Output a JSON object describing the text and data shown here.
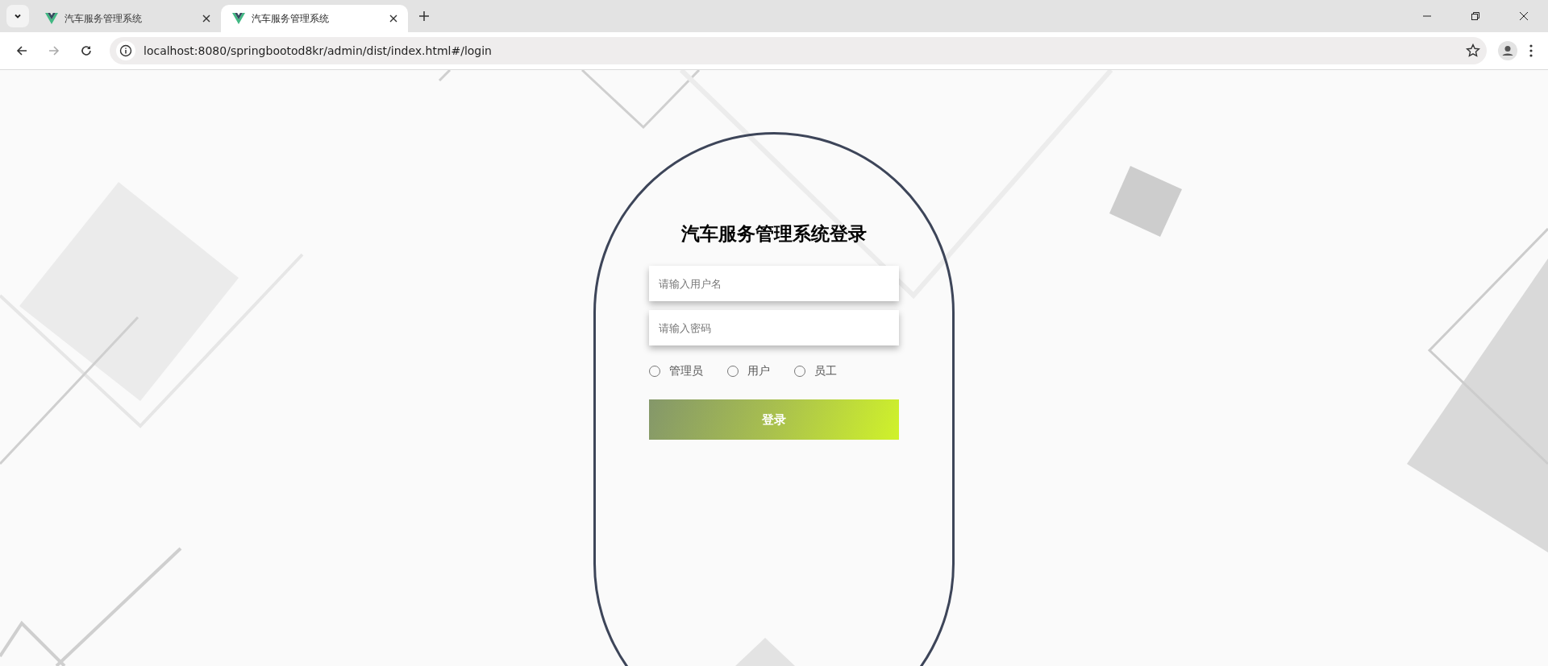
{
  "browser": {
    "tabs": [
      {
        "title": "汽车服务管理系统",
        "selected": false
      },
      {
        "title": "汽车服务管理系统",
        "selected": true
      }
    ],
    "address": "localhost:8080/springbootod8kr/admin/dist/index.html#/login"
  },
  "login": {
    "title": "汽车服务管理系统登录",
    "fields": [
      {
        "placeholder": "请输入用户名"
      },
      {
        "placeholder": "请输入密码"
      }
    ],
    "roles": [
      {
        "label": "管理员",
        "selected": false
      },
      {
        "label": "用户",
        "selected": false
      },
      {
        "label": "员工",
        "selected": false
      }
    ],
    "button": "登录"
  }
}
